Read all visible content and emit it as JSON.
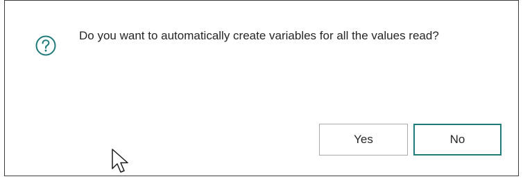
{
  "dialog": {
    "icon": "question-circle-icon",
    "message": "Do you want to automatically create variables for all the values read?",
    "buttons": {
      "yes_label": "Yes",
      "no_label": "No"
    },
    "accent_color": "#1f7a7a"
  },
  "cursor": {
    "icon": "mouse-pointer-icon"
  }
}
